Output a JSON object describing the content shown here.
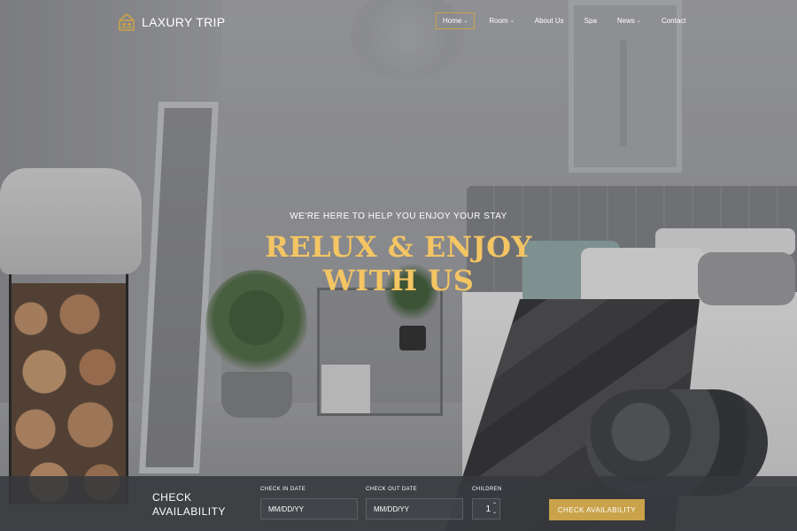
{
  "brand": {
    "name": "LAXURY TRIP",
    "logo_icon": "hotel-bed-icon",
    "accent_color": "#c9a24a"
  },
  "nav": {
    "items": [
      {
        "label": "Home",
        "has_dropdown": true,
        "active": true
      },
      {
        "label": "Room",
        "has_dropdown": true,
        "active": false
      },
      {
        "label": "About Us",
        "has_dropdown": false,
        "active": false
      },
      {
        "label": "Spa",
        "has_dropdown": false,
        "active": false
      },
      {
        "label": "News",
        "has_dropdown": true,
        "active": false
      },
      {
        "label": "Contact",
        "has_dropdown": false,
        "active": false
      }
    ]
  },
  "hero": {
    "tagline": "WE'RE HERE TO HELP YOU ENJOY YOUR STAY",
    "title_line1": "RELUX & ENJOY",
    "title_line2": "WITH US",
    "title_color": "#f3c563"
  },
  "booking": {
    "title_line1": "CHECK",
    "title_line2": "AVAILABILITY",
    "check_in": {
      "label": "CHECK IN DATE",
      "placeholder": "MM/DD/YY"
    },
    "check_out": {
      "label": "CHECK OUT DATE",
      "placeholder": "MM/DD/YY"
    },
    "children": {
      "label": "CHILDREN",
      "value": "1"
    },
    "submit_label": "CHECK AVAILABILITY"
  }
}
